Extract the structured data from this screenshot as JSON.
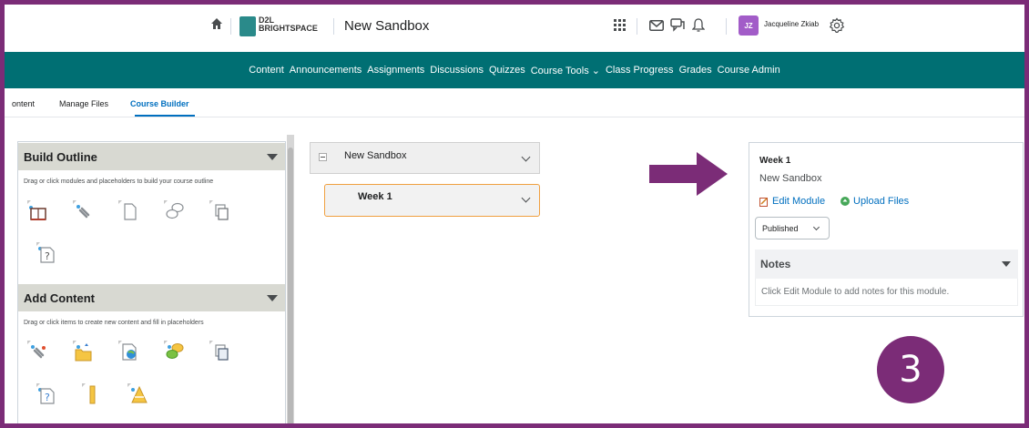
{
  "header": {
    "logo_line1": "D2L",
    "logo_line2": "BRIGHTSPACE",
    "course_title": "New Sandbox",
    "avatar_initials": "JZ",
    "user_name": "Jacqueline Zkiab"
  },
  "nav": {
    "items": [
      "Content",
      "Announcements",
      "Assignments",
      "Discussions",
      "Quizzes",
      "Course Tools ⌄",
      "Class Progress",
      "Grades",
      "Course Admin"
    ]
  },
  "tabs": [
    "ontent",
    "Manage Files",
    "Course Builder"
  ],
  "left_panel": {
    "build_outline": {
      "title": "Build Outline",
      "description": "Drag or click modules and placeholders to build your course outline"
    },
    "add_content": {
      "title": "Add Content",
      "description": "Drag or click items to create new content and fill in placeholders"
    }
  },
  "outline": {
    "root": "New Sandbox",
    "child": "Week 1"
  },
  "details": {
    "title": "Week 1",
    "subtitle": "New Sandbox",
    "edit_link": "Edit Module",
    "upload_link": "Upload Files",
    "status": "Published",
    "notes_title": "Notes",
    "notes_text": "Click Edit Module to add notes for this module."
  },
  "step_number": "3",
  "colors": {
    "frame": "#7b2c77",
    "nav": "#006f73",
    "link": "#006fbf",
    "highlight": "#f0a040"
  }
}
